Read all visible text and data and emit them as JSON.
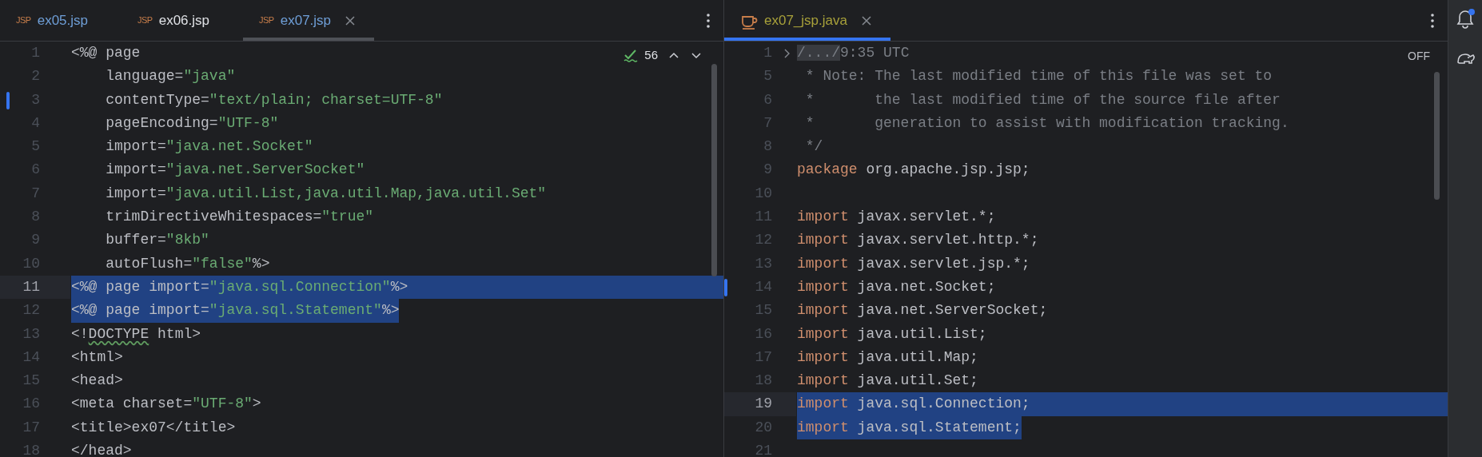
{
  "panes": [
    {
      "focused": false,
      "inspection": {
        "count": "56"
      },
      "tabs": [
        {
          "kind": "jsp",
          "icon_label": "JSP",
          "label": "ex05.jsp",
          "color": "#6f9fd8",
          "selected": false
        },
        {
          "kind": "jsp",
          "icon_label": "JSP",
          "label": "ex06.jsp",
          "color": "#dfe1e5",
          "selected": false
        },
        {
          "kind": "jsp",
          "icon_label": "JSP",
          "label": "ex07.jsp",
          "color": "#6f9fd8",
          "selected": true
        }
      ],
      "lines": [
        {
          "number": "1",
          "selected": false,
          "current": false,
          "changed": false,
          "foldable": false,
          "segments": [
            {
              "kind": "plain",
              "text": "<%@ page"
            }
          ]
        },
        {
          "number": "2",
          "selected": false,
          "current": false,
          "changed": false,
          "foldable": false,
          "segments": [
            {
              "kind": "plain",
              "text": "    language="
            },
            {
              "kind": "string",
              "text": "\"java\""
            }
          ]
        },
        {
          "number": "3",
          "selected": false,
          "current": false,
          "changed": true,
          "foldable": false,
          "segments": [
            {
              "kind": "plain",
              "text": "    contentType="
            },
            {
              "kind": "string",
              "text": "\"text/plain; charset=UTF-8\""
            }
          ]
        },
        {
          "number": "4",
          "selected": false,
          "current": false,
          "changed": false,
          "foldable": false,
          "segments": [
            {
              "kind": "plain",
              "text": "    pageEncoding="
            },
            {
              "kind": "string",
              "text": "\"UTF-8\""
            }
          ]
        },
        {
          "number": "5",
          "selected": false,
          "current": false,
          "changed": false,
          "foldable": false,
          "segments": [
            {
              "kind": "plain",
              "text": "    import="
            },
            {
              "kind": "string",
              "text": "\"java.net.Socket\""
            }
          ]
        },
        {
          "number": "6",
          "selected": false,
          "current": false,
          "changed": false,
          "foldable": false,
          "segments": [
            {
              "kind": "plain",
              "text": "    import="
            },
            {
              "kind": "string",
              "text": "\"java.net.ServerSocket\""
            }
          ]
        },
        {
          "number": "7",
          "selected": false,
          "current": false,
          "changed": false,
          "foldable": false,
          "segments": [
            {
              "kind": "plain",
              "text": "    import="
            },
            {
              "kind": "string",
              "text": "\"java.util.List,java.util.Map,java.util.Set\""
            }
          ]
        },
        {
          "number": "8",
          "selected": false,
          "current": false,
          "changed": false,
          "foldable": false,
          "segments": [
            {
              "kind": "plain",
              "text": "    trimDirectiveWhitespaces="
            },
            {
              "kind": "string",
              "text": "\"true\""
            }
          ]
        },
        {
          "number": "9",
          "selected": false,
          "current": false,
          "changed": false,
          "foldable": false,
          "segments": [
            {
              "kind": "plain",
              "text": "    buffer="
            },
            {
              "kind": "string",
              "text": "\"8kb\""
            }
          ]
        },
        {
          "number": "10",
          "selected": false,
          "current": false,
          "changed": false,
          "foldable": false,
          "segments": [
            {
              "kind": "plain",
              "text": "    autoFlush="
            },
            {
              "kind": "string",
              "text": "\"false\""
            },
            {
              "kind": "plain",
              "text": "%>"
            }
          ]
        },
        {
          "number": "11",
          "selected": true,
          "current": true,
          "changed": false,
          "foldable": false,
          "segments": [
            {
              "kind": "plain",
              "text": "<%@ page import="
            },
            {
              "kind": "string",
              "text": "\"java.sql.Connection\""
            },
            {
              "kind": "plain",
              "text": "%>"
            }
          ]
        },
        {
          "number": "12",
          "selected": true,
          "current": false,
          "changed": false,
          "foldable": false,
          "segments": [
            {
              "kind": "plain",
              "text": "<%@ page import="
            },
            {
              "kind": "string",
              "text": "\"java.sql.Statement\""
            },
            {
              "kind": "plain",
              "text": "%>"
            }
          ]
        },
        {
          "number": "13",
          "selected": false,
          "current": false,
          "changed": false,
          "foldable": false,
          "segments": [
            {
              "kind": "plain",
              "text": "<!"
            },
            {
              "kind": "typo",
              "text": "DOCTYPE"
            },
            {
              "kind": "plain",
              "text": " html>"
            }
          ]
        },
        {
          "number": "14",
          "selected": false,
          "current": false,
          "changed": false,
          "foldable": false,
          "segments": [
            {
              "kind": "plain",
              "text": "<html>"
            }
          ]
        },
        {
          "number": "15",
          "selected": false,
          "current": false,
          "changed": false,
          "foldable": false,
          "segments": [
            {
              "kind": "plain",
              "text": "<head>"
            }
          ]
        },
        {
          "number": "16",
          "selected": false,
          "current": false,
          "changed": false,
          "foldable": false,
          "segments": [
            {
              "kind": "plain",
              "text": "<meta charset="
            },
            {
              "kind": "string",
              "text": "\"UTF-8\""
            },
            {
              "kind": "plain",
              "text": ">"
            }
          ]
        },
        {
          "number": "17",
          "selected": false,
          "current": false,
          "changed": false,
          "foldable": false,
          "segments": [
            {
              "kind": "plain",
              "text": "<title>ex07</title>"
            }
          ]
        },
        {
          "number": "18",
          "selected": false,
          "current": false,
          "changed": false,
          "foldable": false,
          "segments": [
            {
              "kind": "plain",
              "text": "</head>"
            }
          ]
        }
      ]
    },
    {
      "focused": true,
      "reader_mode": "OFF",
      "tabs": [
        {
          "kind": "java",
          "label": "ex07_jsp.java",
          "color": "#a8a13a",
          "selected": true
        }
      ],
      "lines": [
        {
          "number": "1",
          "selected": false,
          "current": false,
          "changed": false,
          "foldable": true,
          "segments": [
            {
              "kind": "folded",
              "text": "/.../"
            },
            {
              "kind": "comment",
              "text": "9:35 UTC"
            }
          ]
        },
        {
          "number": "5",
          "selected": false,
          "current": false,
          "changed": false,
          "foldable": false,
          "segments": [
            {
              "kind": "comment",
              "text": " * Note: The last modified time of this file was set to"
            }
          ]
        },
        {
          "number": "6",
          "selected": false,
          "current": false,
          "changed": false,
          "foldable": false,
          "segments": [
            {
              "kind": "comment",
              "text": " *       the last modified time of the source file after"
            }
          ]
        },
        {
          "number": "7",
          "selected": false,
          "current": false,
          "changed": false,
          "foldable": false,
          "segments": [
            {
              "kind": "comment",
              "text": " *       generation to assist with modification tracking."
            }
          ]
        },
        {
          "number": "8",
          "selected": false,
          "current": false,
          "changed": false,
          "foldable": false,
          "segments": [
            {
              "kind": "comment",
              "text": " */"
            }
          ]
        },
        {
          "number": "9",
          "selected": false,
          "current": false,
          "changed": false,
          "foldable": false,
          "segments": [
            {
              "kind": "keyword",
              "text": "package"
            },
            {
              "kind": "plain",
              "text": " org.apache.jsp.jsp;"
            }
          ]
        },
        {
          "number": "10",
          "selected": false,
          "current": false,
          "changed": false,
          "foldable": false
        },
        {
          "number": "11",
          "selected": false,
          "current": false,
          "changed": false,
          "foldable": false,
          "segments": [
            {
              "kind": "keyword",
              "text": "import"
            },
            {
              "kind": "plain",
              "text": " javax.servlet.*;"
            }
          ]
        },
        {
          "number": "12",
          "selected": false,
          "current": false,
          "changed": false,
          "foldable": false,
          "segments": [
            {
              "kind": "keyword",
              "text": "import"
            },
            {
              "kind": "plain",
              "text": " javax.servlet.http.*;"
            }
          ]
        },
        {
          "number": "13",
          "selected": false,
          "current": false,
          "changed": false,
          "foldable": false,
          "segments": [
            {
              "kind": "keyword",
              "text": "import"
            },
            {
              "kind": "plain",
              "text": " javax.servlet.jsp.*;"
            }
          ]
        },
        {
          "number": "14",
          "selected": false,
          "current": false,
          "changed": true,
          "foldable": false,
          "segments": [
            {
              "kind": "keyword",
              "text": "import"
            },
            {
              "kind": "plain",
              "text": " java.net.Socket;"
            }
          ]
        },
        {
          "number": "15",
          "selected": false,
          "current": false,
          "changed": false,
          "foldable": false,
          "segments": [
            {
              "kind": "keyword",
              "text": "import"
            },
            {
              "kind": "plain",
              "text": " java.net.ServerSocket;"
            }
          ]
        },
        {
          "number": "16",
          "selected": false,
          "current": false,
          "changed": false,
          "foldable": false,
          "segments": [
            {
              "kind": "keyword",
              "text": "import"
            },
            {
              "kind": "plain",
              "text": " java.util.List;"
            }
          ]
        },
        {
          "number": "17",
          "selected": false,
          "current": false,
          "changed": false,
          "foldable": false,
          "segments": [
            {
              "kind": "keyword",
              "text": "import"
            },
            {
              "kind": "plain",
              "text": " java.util.Map;"
            }
          ]
        },
        {
          "number": "18",
          "selected": false,
          "current": false,
          "changed": false,
          "foldable": false,
          "segments": [
            {
              "kind": "keyword",
              "text": "import"
            },
            {
              "kind": "plain",
              "text": " java.util.Set;"
            }
          ]
        },
        {
          "number": "19",
          "selected": true,
          "current": true,
          "changed": false,
          "foldable": false,
          "segments": [
            {
              "kind": "keyword",
              "text": "import"
            },
            {
              "kind": "plain",
              "text": " java.sql.Connection;"
            }
          ]
        },
        {
          "number": "20",
          "selected": true,
          "current": false,
          "changed": false,
          "foldable": false,
          "segments": [
            {
              "kind": "keyword",
              "text": "import"
            },
            {
              "kind": "plain",
              "text": " java.sql.Statement;"
            }
          ]
        },
        {
          "number": "21",
          "selected": false,
          "current": false,
          "changed": false,
          "foldable": false
        }
      ]
    }
  ],
  "sidebar": {
    "unread_notifications": true
  }
}
